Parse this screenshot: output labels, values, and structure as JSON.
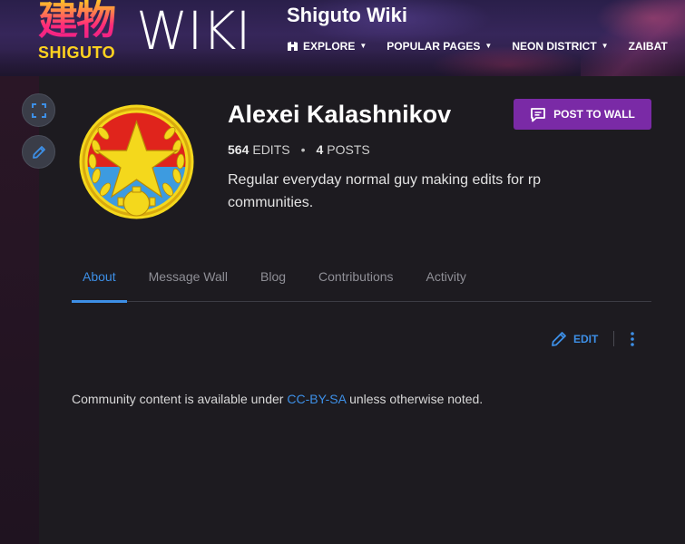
{
  "site": {
    "logo_kanji": "建物",
    "logo_sub": "SHIGUTO",
    "logo_wiki": "WIKI",
    "title": "Shiguto Wiki"
  },
  "nav": {
    "items": [
      {
        "label": "EXPLORE",
        "icon": "explore-icon"
      },
      {
        "label": "POPULAR PAGES"
      },
      {
        "label": "NEON DISTRICT"
      },
      {
        "label": "ZAIBAT"
      }
    ]
  },
  "profile": {
    "username": "Alexei Kalashnikov",
    "edits_count": "564",
    "edits_label": "EDITS",
    "separator": "•",
    "posts_count": "4",
    "posts_label": "POSTS",
    "bio": "Regular everyday normal guy making edits for rp communities.",
    "post_wall_label": "POST TO WALL"
  },
  "tabs": [
    {
      "label": "About",
      "active": true
    },
    {
      "label": "Message Wall",
      "active": false
    },
    {
      "label": "Blog",
      "active": false
    },
    {
      "label": "Contributions",
      "active": false
    },
    {
      "label": "Activity",
      "active": false
    }
  ],
  "actions": {
    "edit_label": "EDIT"
  },
  "license": {
    "prefix": "Community content is available under ",
    "link": "CC-BY-SA",
    "suffix": " unless otherwise noted."
  },
  "colors": {
    "accent_blue": "#3d8fe6",
    "post_wall_purple": "#7a2aa6",
    "background": "#1d1b20",
    "logo_yellow": "#ffd21f",
    "logo_pink": "#ff2a7a"
  }
}
